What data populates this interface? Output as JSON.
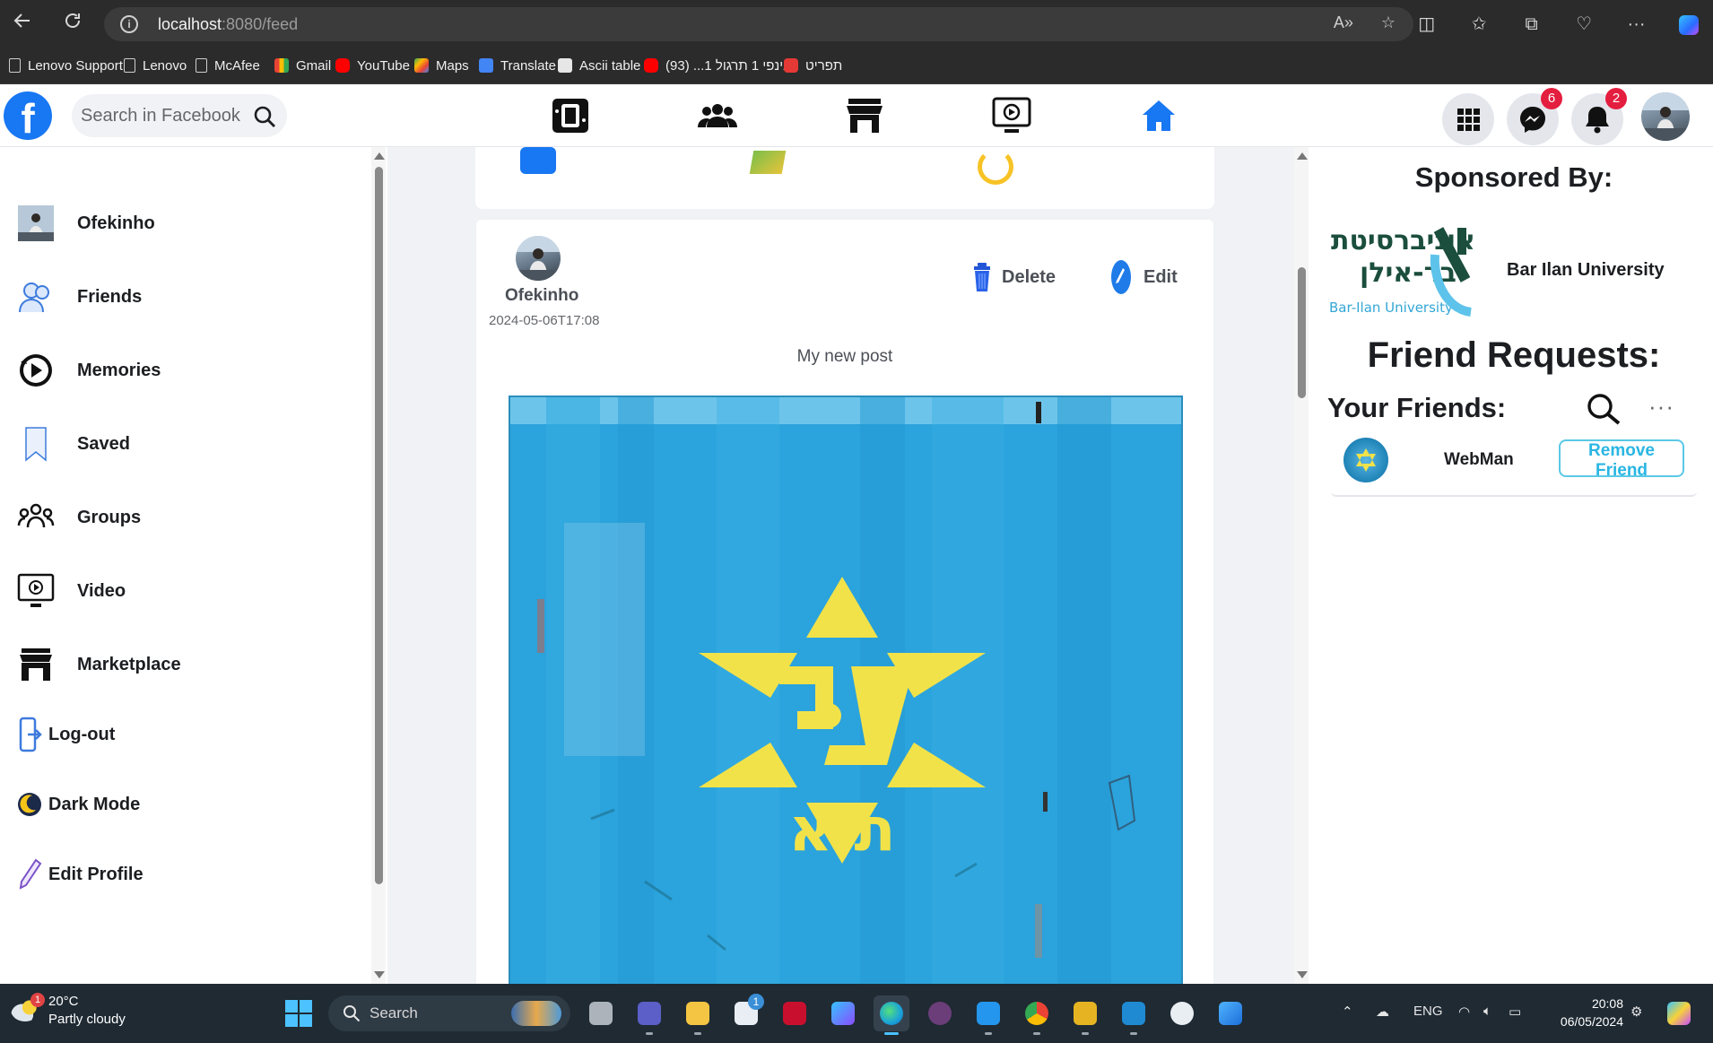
{
  "browser": {
    "url_host": "localhost",
    "url_path": ":8080/feed",
    "bookmarks": [
      {
        "label": "Lenovo Support",
        "icon": "page-icon"
      },
      {
        "label": "Lenovo",
        "icon": "page-icon"
      },
      {
        "label": "McAfee",
        "icon": "page-icon"
      },
      {
        "label": "Gmail",
        "icon": "gmail-icon"
      },
      {
        "label": "YouTube",
        "icon": "youtube-icon"
      },
      {
        "label": "Maps",
        "icon": "maps-icon"
      },
      {
        "label": "Translate",
        "icon": "translate-icon"
      },
      {
        "label": "Ascii table",
        "icon": "jbw-icon"
      },
      {
        "label": "אינפי 1 תרגול 1... (93)",
        "icon": "youtube-icon"
      },
      {
        "label": "תפריט",
        "icon": "pdf-icon"
      }
    ]
  },
  "header": {
    "search_placeholder": "Search in Facebook",
    "messenger_badge": "6",
    "notifications_badge": "2"
  },
  "sidebar": {
    "items": [
      {
        "label": "Ofekinho",
        "icon": "profile-avatar"
      },
      {
        "label": "Friends",
        "icon": "friends-icon"
      },
      {
        "label": "Memories",
        "icon": "memories-icon"
      },
      {
        "label": "Saved",
        "icon": "bookmark-icon"
      },
      {
        "label": "Groups",
        "icon": "groups-icon"
      },
      {
        "label": "Video",
        "icon": "video-icon"
      },
      {
        "label": "Marketplace",
        "icon": "marketplace-icon"
      },
      {
        "label": "Log-out",
        "icon": "logout-icon"
      },
      {
        "label": "Dark Mode",
        "icon": "moon-icon"
      },
      {
        "label": "Edit Profile",
        "icon": "pencil-icon"
      }
    ]
  },
  "post": {
    "author": "Ofekinho",
    "timestamp": "2024-05-06T17:08",
    "text": "My new post",
    "delete_label": "Delete",
    "edit_label": "Edit",
    "image_caption": "ת א"
  },
  "right": {
    "sponsored_title": "Sponsored By:",
    "sponsor_name": "Bar Ilan University",
    "sponsor_logo_text_line1": "אוניברסיטת",
    "sponsor_logo_text_line2": "בר-אילן",
    "sponsor_logo_text_line3": "Bar-Ilan University",
    "friend_requests_title": "Friend Requests:",
    "friends_title": "Your Friends:",
    "more_label": "···",
    "friends": [
      {
        "name": "WebMan",
        "action_label": "Remove Friend"
      }
    ]
  },
  "taskbar": {
    "weather_temp": "20°C",
    "weather_desc": "Partly cloudy",
    "weather_badge": "1",
    "search_label": "Search",
    "store_badge": "1",
    "language": "ENG",
    "time": "20:08",
    "date": "06/05/2024"
  },
  "colors": {
    "fb_blue": "#1877f2",
    "badge_red": "#e41e3f",
    "remove_button": "#29b6e3",
    "post_image_bg": "#2ba3dc",
    "emblem_yellow": "#f2e24a"
  }
}
